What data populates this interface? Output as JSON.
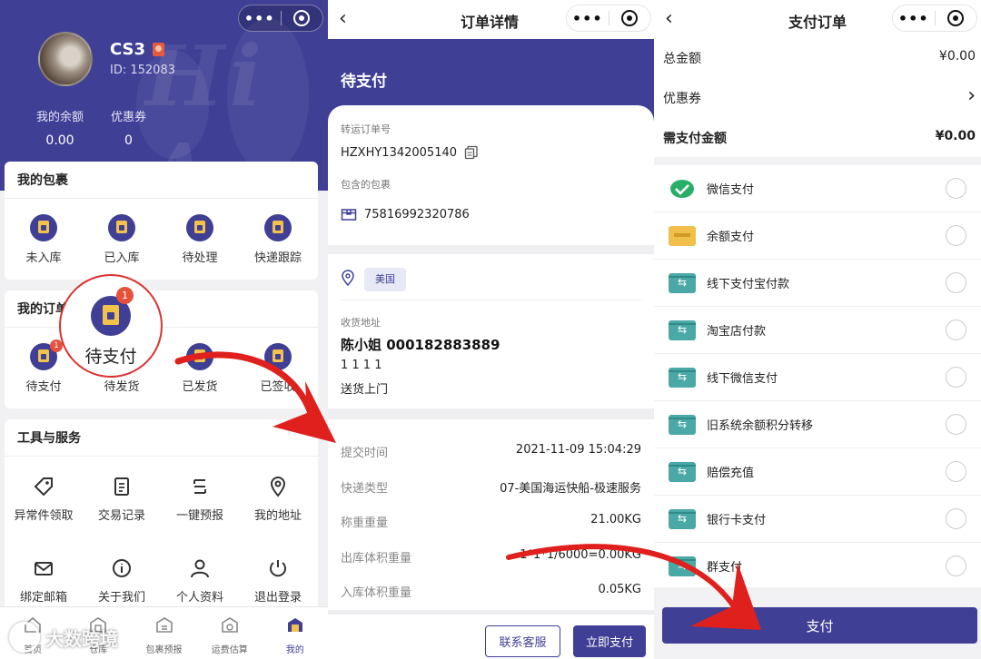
{
  "panel1": {
    "user": {
      "name": "CS3",
      "id": "ID: 152083"
    },
    "stats": [
      {
        "label": "我的余额",
        "value": "0.00"
      },
      {
        "label": "优惠券",
        "value": "0"
      }
    ],
    "packages": {
      "title": "我的包裹",
      "items": [
        "未入库",
        "已入库",
        "待处理",
        "快递跟踪"
      ]
    },
    "orders": {
      "title": "我的订单",
      "items": [
        "待支付",
        "待发货",
        "已发货",
        "已签收"
      ],
      "badge": "1"
    },
    "zoom": {
      "label": "待支付",
      "badge": "1"
    },
    "tools": {
      "title": "工具与服务",
      "items": [
        "异常件领取",
        "交易记录",
        "一键预报",
        "我的地址",
        "绑定邮箱",
        "关于我们",
        "个人资料",
        "退出登录"
      ]
    },
    "tabs": [
      "首页",
      "仓库",
      "包裹预报",
      "运费估算",
      "我的"
    ],
    "watermark": "大数跨境"
  },
  "panel2": {
    "nav_title": "订单详情",
    "status": "待支付",
    "transfer_label": "转运订单号",
    "transfer_no": "HZXHY1342005140",
    "package_label": "包含的包裹",
    "package_no": "75816992320786",
    "country": "美国",
    "addr_label": "收货地址",
    "addr_name": "陈小姐 000182883889",
    "addr_line": "1 1 1 1",
    "addr_type": "送货上门",
    "details": [
      {
        "k": "提交时间",
        "v": "2021-11-09 15:04:29"
      },
      {
        "k": "快递类型",
        "v": "07-美国海运快船-极速服务"
      },
      {
        "k": "称重重量",
        "v": "21.00KG"
      },
      {
        "k": "出库体积重量",
        "v": "1*1*1/6000=0.00KG"
      },
      {
        "k": "入库体积重量",
        "v": "0.05KG"
      }
    ],
    "btn_contact": "联系客服",
    "btn_pay": "立即支付"
  },
  "panel3": {
    "nav_title": "支付订单",
    "total_label": "总金额",
    "total_value": "¥0.00",
    "coupon_label": "优惠券",
    "coupon_arrow": "›",
    "due_label": "需支付金额",
    "due_value": "¥0.00",
    "methods": [
      "微信支付",
      "余额支付",
      "线下支付宝付款",
      "淘宝店付款",
      "线下微信支付",
      "旧系统余额积分转移",
      "赔偿充值",
      "银行卡支付",
      "群支付"
    ],
    "pay_button": "支付"
  },
  "colors": {
    "primary": "#3f3f96",
    "accent_red": "#e6513c",
    "arrow_red": "#e0201c",
    "teal": "#4aa8a6",
    "gold": "#f1c04a",
    "wechat": "#2aae67"
  }
}
